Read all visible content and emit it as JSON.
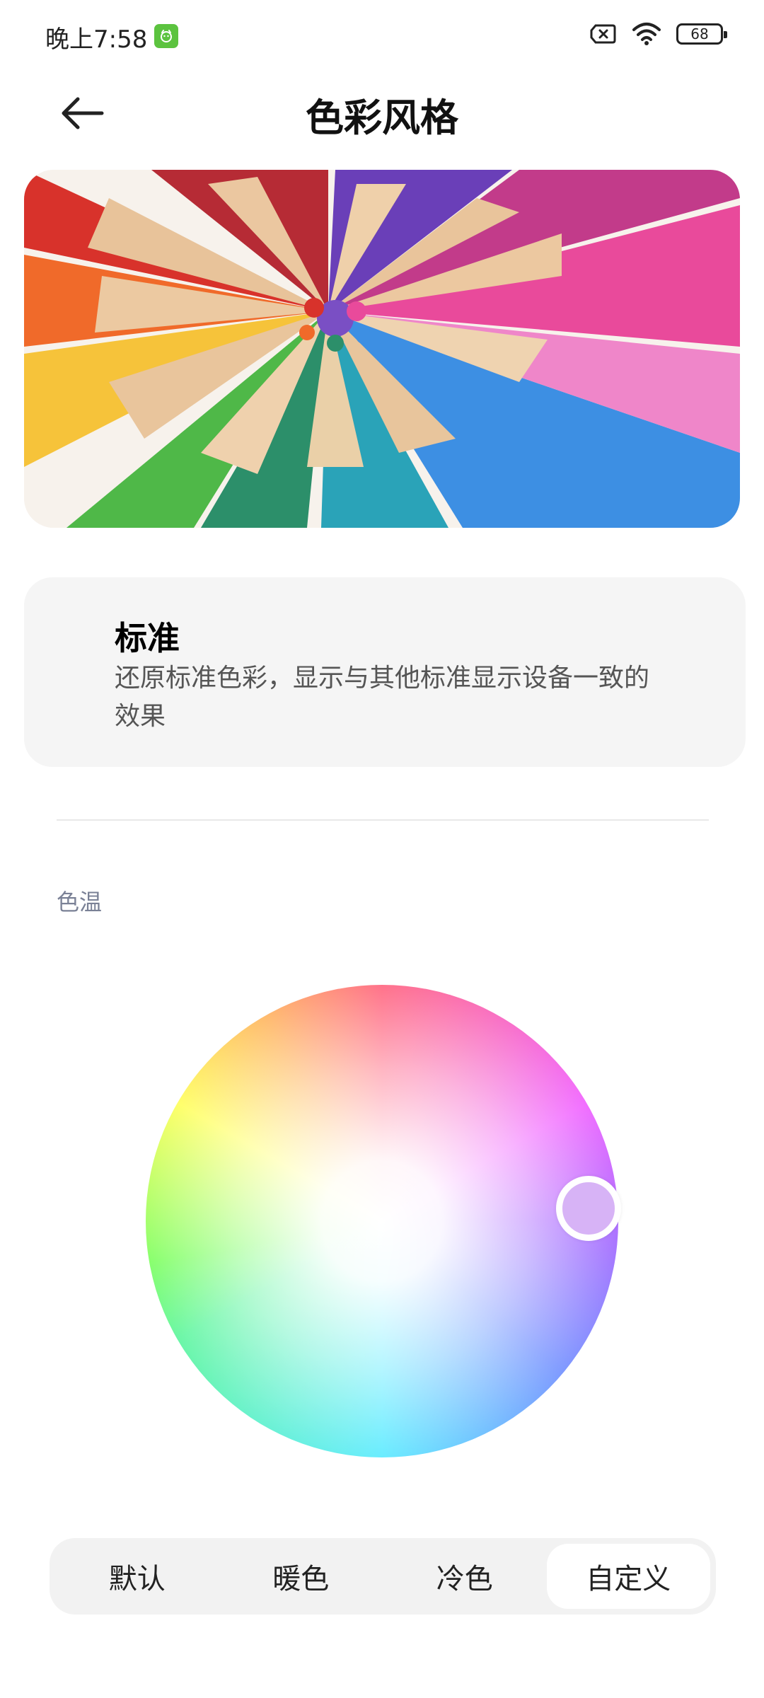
{
  "status_bar": {
    "time": "晚上7:58",
    "battery": "68",
    "icons": [
      "app-notification-icon",
      "sim-off-icon",
      "wifi-icon",
      "battery-icon"
    ]
  },
  "header": {
    "title": "色彩风格",
    "back_icon": "arrow-left-icon"
  },
  "mode_card": {
    "title": "标准",
    "description": "还原标准色彩，显示与其他标准显示设备一致的效果"
  },
  "color_temperature": {
    "label": "色温"
  },
  "segments": [
    {
      "label": "默认",
      "selected": false
    },
    {
      "label": "暖色",
      "selected": false
    },
    {
      "label": "冷色",
      "selected": false
    },
    {
      "label": "自定义",
      "selected": true
    }
  ],
  "colors": {
    "card_bg": "#f5f5f5",
    "segment_bg": "#f2f2f2",
    "segment_active_bg": "#ffffff",
    "section_label": "#7a8196",
    "handle_fill": "#d7b3f6"
  }
}
